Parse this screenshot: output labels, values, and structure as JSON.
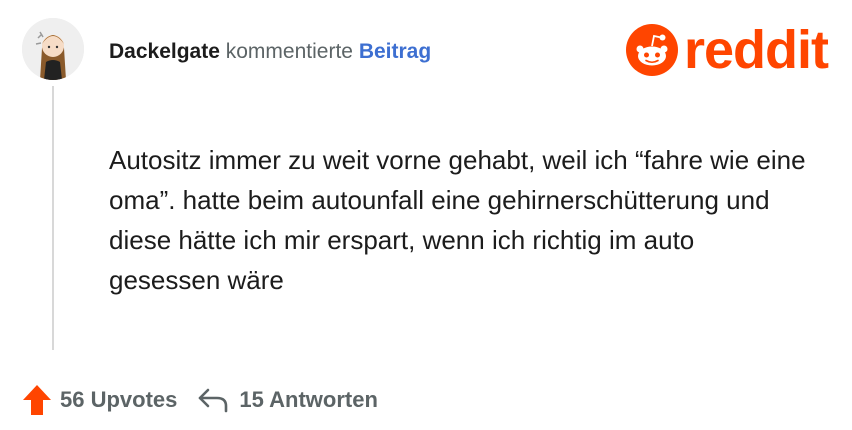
{
  "comment": {
    "username": "Dackelgate",
    "action": "kommentierte",
    "post_link": "Beitrag",
    "text": "Autositz immer zu weit vorne gehabt, weil ich “fahre wie eine oma”. hatte beim autounfall eine gehirnerschütterung und diese hätte ich mir erspart, wenn ich richtig im auto gesessen wäre"
  },
  "brand": {
    "name": "reddit",
    "color": "#ff4500",
    "icon": "reddit-snoo-icon"
  },
  "stats": {
    "upvotes": "56 Upvotes",
    "replies": "15 Antworten",
    "upvote_icon": "upvote-arrow-icon",
    "reply_icon": "reply-arrow-icon",
    "upvote_color": "#ff4500"
  },
  "colors": {
    "link": "#3d6fd1",
    "muted": "#5c6466",
    "thread_line": "#d8d8d8"
  }
}
